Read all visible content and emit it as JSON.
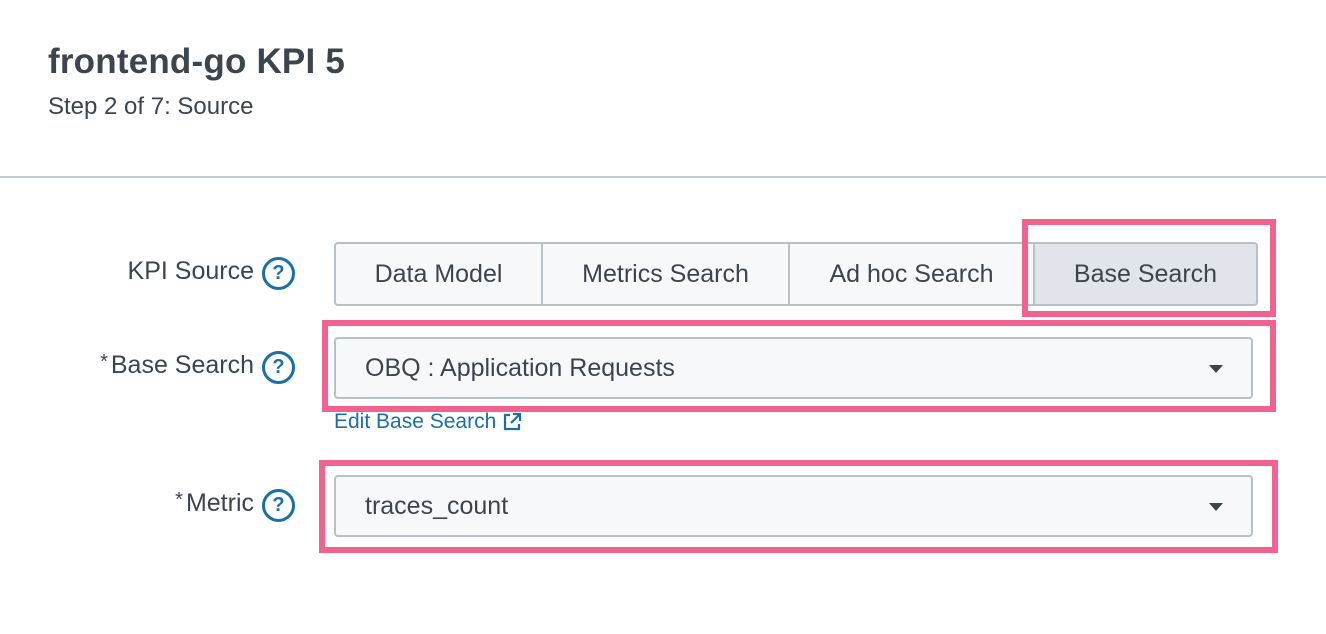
{
  "header": {
    "title": "frontend-go KPI 5",
    "subtitle": "Step 2 of 7: Source"
  },
  "form": {
    "kpi_source": {
      "label": "KPI Source",
      "help": "?",
      "options": [
        "Data Model",
        "Metrics Search",
        "Ad hoc Search",
        "Base Search"
      ],
      "selected": "Base Search"
    },
    "base_search": {
      "required_mark": "*",
      "label": "Base Search",
      "help": "?",
      "value": "OBQ : Application Requests",
      "edit_link": "Edit Base Search",
      "edit_icon": "external-link-icon"
    },
    "metric": {
      "required_mark": "*",
      "label": "Metric",
      "help": "?",
      "value": "traces_count"
    }
  },
  "colors": {
    "text": "#3c444d",
    "link": "#1a6fa8",
    "highlight": "#f2628e",
    "active_segment": "#e1e5eb"
  }
}
